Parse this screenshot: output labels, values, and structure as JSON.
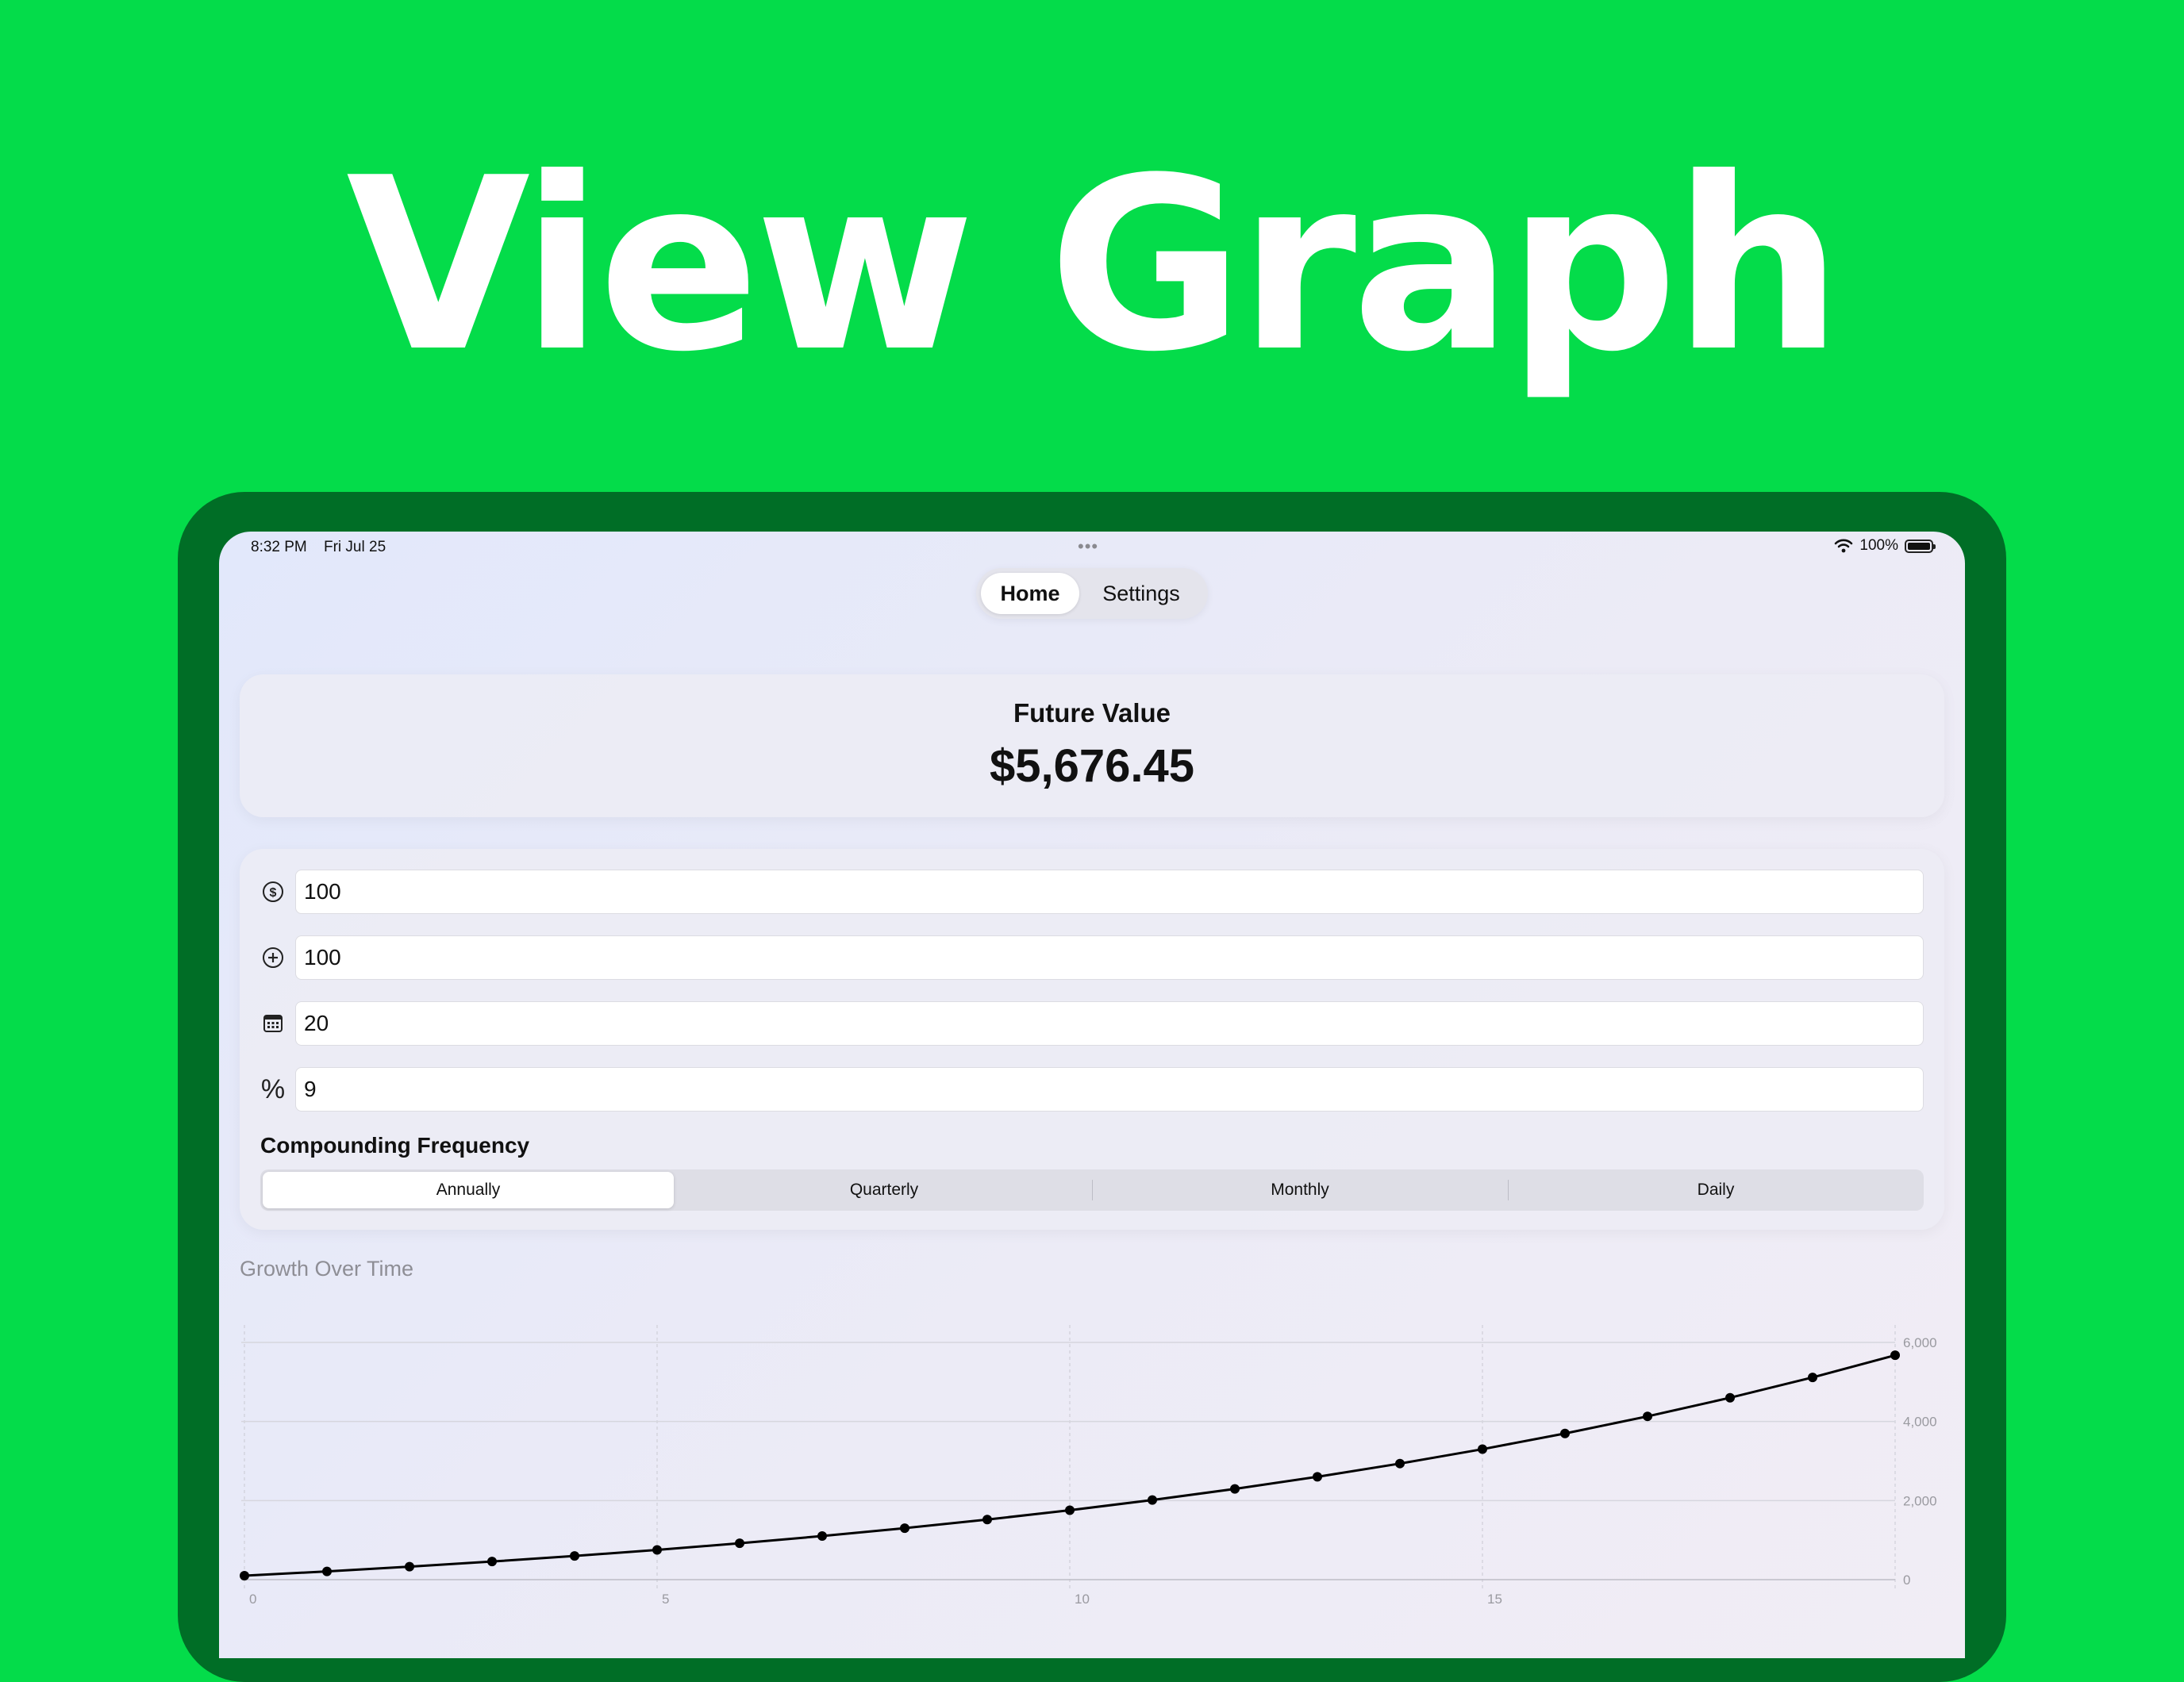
{
  "promo": {
    "title": "View Graph"
  },
  "status_bar": {
    "time": "8:32 PM",
    "date": "Fri Jul 25",
    "battery": "100%"
  },
  "nav": {
    "tabs": [
      {
        "label": "Home",
        "selected": true
      },
      {
        "label": "Settings",
        "selected": false
      }
    ]
  },
  "future_value": {
    "label": "Future Value",
    "value": "$5,676.45"
  },
  "inputs": {
    "initial_amount": {
      "icon": "dollar-circle-icon",
      "value": "100"
    },
    "contribution": {
      "icon": "plus-circle-icon",
      "value": "100"
    },
    "years": {
      "icon": "calendar-icon",
      "value": "20"
    },
    "rate": {
      "icon": "percent-icon",
      "symbol": "%",
      "value": "9"
    }
  },
  "compounding": {
    "label": "Compounding Frequency",
    "options": [
      "Annually",
      "Quarterly",
      "Monthly",
      "Daily"
    ],
    "selected": "Annually"
  },
  "chart": {
    "section_title": "Growth Over Time"
  },
  "chart_data": {
    "type": "line",
    "title": "Growth Over Time",
    "xlabel": "",
    "ylabel": "",
    "x": [
      0,
      1,
      2,
      3,
      4,
      5,
      6,
      7,
      8,
      9,
      10,
      11,
      12,
      13,
      14,
      15,
      16,
      17,
      18,
      19,
      20
    ],
    "series": [
      {
        "values": [
          100,
          209,
          328,
          458,
          599,
          752,
          920,
          1103,
          1302,
          1520,
          1756,
          2014,
          2295,
          2602,
          2936,
          3300,
          3697,
          4130,
          4601,
          5115,
          5676
        ]
      }
    ],
    "x_ticks": [
      "0",
      "5",
      "10",
      "15"
    ],
    "y_ticks": [
      "0",
      "2,000",
      "4,000",
      "6,000"
    ],
    "xlim": [
      0,
      20
    ],
    "ylim": [
      0,
      6000
    ],
    "grid": true,
    "y_axis_side": "right"
  },
  "colors": {
    "background": "#04dc4a",
    "device_frame": "#006e26",
    "line": "#000000"
  }
}
